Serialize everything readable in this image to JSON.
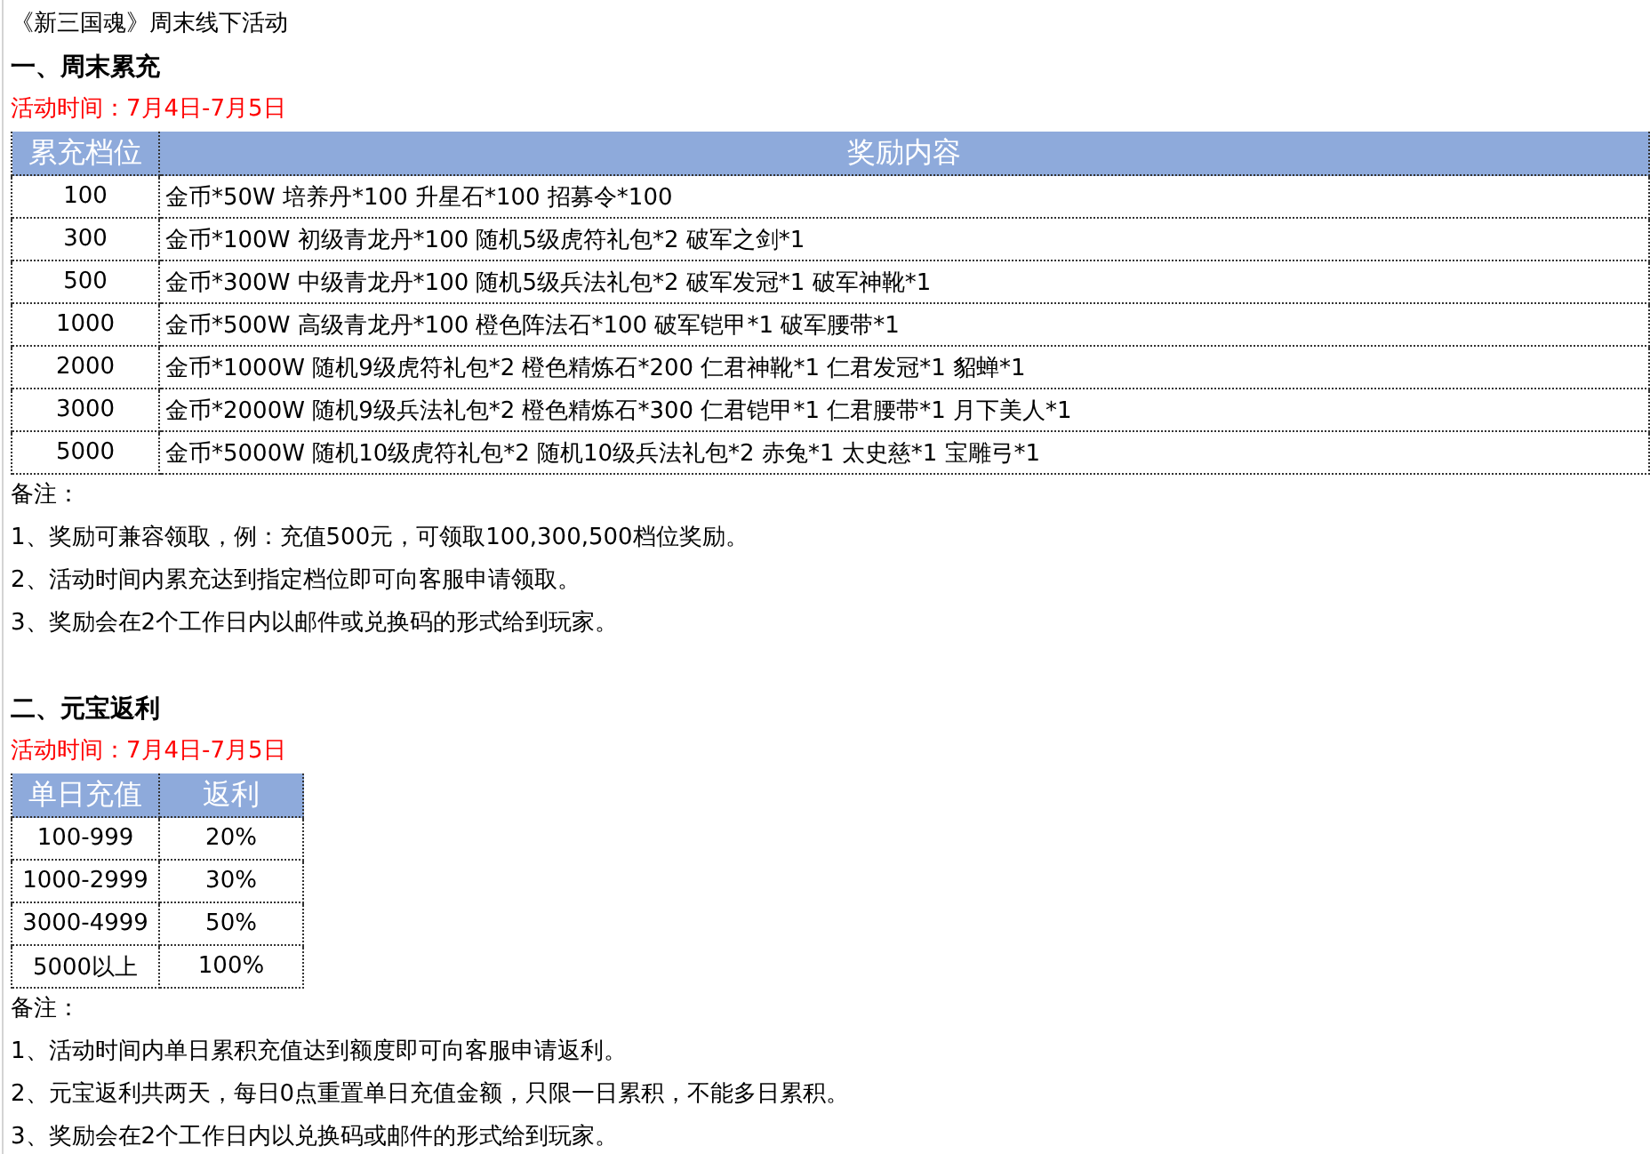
{
  "title": "《新三国魂》周末线下活动",
  "sections": [
    {
      "heading": "一、周末累充",
      "time": "活动时间：7月4日-7月5日",
      "kind": "wide",
      "columns": [
        "累充档位",
        "奖励内容"
      ],
      "rows": [
        [
          "100",
          "金币*50W  培养丹*100  升星石*100  招募令*100"
        ],
        [
          "300",
          "金币*100W  初级青龙丹*100  随机5级虎符礼包*2  破军之剑*1"
        ],
        [
          "500",
          "金币*300W  中级青龙丹*100  随机5级兵法礼包*2  破军发冠*1  破军神靴*1"
        ],
        [
          "1000",
          "金币*500W  高级青龙丹*100  橙色阵法石*100  破军铠甲*1  破军腰带*1"
        ],
        [
          "2000",
          "金币*1000W  随机9级虎符礼包*2  橙色精炼石*200  仁君神靴*1  仁君发冠*1  貂蝉*1"
        ],
        [
          "3000",
          "金币*2000W  随机9级兵法礼包*2  橙色精炼石*300  仁君铠甲*1  仁君腰带*1  月下美人*1"
        ],
        [
          "5000",
          "金币*5000W  随机10级虎符礼包*2  随机10级兵法礼包*2  赤兔*1  太史慈*1  宝雕弓*1"
        ]
      ],
      "notes_label": "备注：",
      "notes": [
        "1、奖励可兼容领取，例：充值500元，可领取100,300,500档位奖励。",
        "2、活动时间内累充达到指定档位即可向客服申请领取。",
        "3、奖励会在2个工作日内以邮件或兑换码的形式给到玩家。"
      ]
    },
    {
      "heading": "二、元宝返利",
      "time": "活动时间：7月4日-7月5日",
      "kind": "narrow",
      "columns": [
        "单日充值",
        "返利"
      ],
      "rows": [
        [
          "100-999",
          "20%"
        ],
        [
          "1000-2999",
          "30%"
        ],
        [
          "3000-4999",
          "50%"
        ],
        [
          "5000以上",
          "100%"
        ]
      ],
      "notes_label": "备注：",
      "notes": [
        "1、活动时间内单日累积充值达到额度即可向客服申请返利。",
        "2、元宝返利共两天，每日0点重置单日充值金额，只限一日累积，不能多日累积。",
        "3、奖励会在2个工作日内以兑换码或邮件的形式给到玩家。"
      ]
    }
  ]
}
